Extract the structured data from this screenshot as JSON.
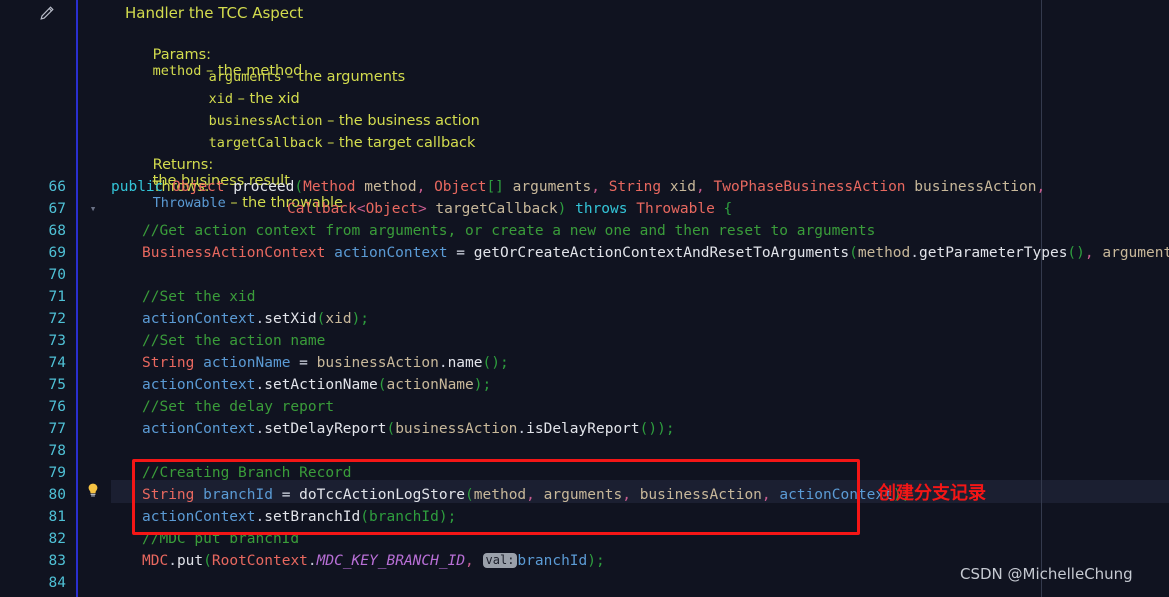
{
  "editor": {
    "background_color": "#101320",
    "gutter_rule_color": "#2a2fd0",
    "column_ruler_color": "#343a4d",
    "current_line": 80,
    "line_numbers": [
      66,
      67,
      68,
      69,
      70,
      71,
      72,
      73,
      74,
      75,
      76,
      77,
      78,
      79,
      80,
      81,
      82,
      83,
      84
    ],
    "fold_marker_line": 67,
    "lightbulb_line": 80,
    "icons": {
      "pencil": "pencil-icon",
      "fold_chevron": "chevron-down-icon",
      "lightbulb": "lightbulb-icon"
    }
  },
  "doc_popup": {
    "title": "Handler the TCC Aspect",
    "params_label": "Params:",
    "params": [
      {
        "name": "method",
        "dash": "–",
        "desc": "the method"
      },
      {
        "name": "arguments",
        "dash": "–",
        "desc": "the arguments"
      },
      {
        "name": "xid",
        "dash": "–",
        "desc": "the xid"
      },
      {
        "name": "businessAction",
        "dash": "–",
        "desc": "the business action"
      },
      {
        "name": "targetCallback",
        "dash": "–",
        "desc": "the target callback"
      }
    ],
    "returns_label": "Returns:",
    "returns_value": "the business result",
    "throws_label": "Throws:",
    "throws_type": "Throwable",
    "throws_dash": "–",
    "throws_desc": "the throwable"
  },
  "code": {
    "line66": {
      "kw_public": "public",
      "type_object": "Object",
      "name_proceed": "proceed",
      "paren_open": "(",
      "type_method": "Method",
      "param_method": " method",
      "comma1": ", ",
      "type_object2": "Object",
      "brackets": "[]",
      "param_arguments": " arguments",
      "comma2": ", ",
      "type_string": "String",
      "param_xid": " xid",
      "comma3": ", ",
      "type_twophase": "TwoPhaseBusinessAction",
      "param_businessaction": " businessAction",
      "comma4": ","
    },
    "line67": {
      "type_callback": "Callback",
      "generic_open": "<",
      "type_object": "Object",
      "generic_close": ">",
      "param_target": " targetCallback",
      "paren_close": ")",
      "kw_throws": " throws ",
      "type_throwable": "Throwable",
      "brace": " {"
    },
    "line68": "//Get action context from arguments, or create a new one and then reset to arguments",
    "line69": {
      "type": "BusinessActionContext",
      "var": "actionContext",
      "eq": " = ",
      "call": "getOrCreateActionContextAndResetToArguments",
      "open": "(",
      "arg1": "method",
      "dot": ".",
      "m1": "getParameterTypes",
      "empty": "()",
      "comma": ", ",
      "arg2": "arguments",
      "close": ");"
    },
    "line71": "//Set the xid",
    "line72": {
      "var": "actionContext",
      "dot": ".",
      "call": "setXid",
      "open": "(",
      "arg": "xid",
      "close": ");"
    },
    "line73": "//Set the action name",
    "line74": {
      "type": "String",
      "var": " actionName",
      "eq": " = ",
      "obj": "businessAction",
      "dot": ".",
      "call": "name",
      "close": "();"
    },
    "line75": {
      "var": "actionContext",
      "dot": ".",
      "call": "setActionName",
      "open": "(",
      "arg": "actionName",
      "close": ");"
    },
    "line76": "//Set the delay report",
    "line77": {
      "var": "actionContext",
      "dot": ".",
      "call": "setDelayReport",
      "open": "(",
      "obj": "businessAction",
      "dot2": ".",
      "m": "isDelayReport",
      "close": "());"
    },
    "line79": "//Creating Branch Record",
    "line80": {
      "type": "String",
      "var": " branchId",
      "eq": " = ",
      "call": "doTccActionLogStore",
      "open": "(",
      "a1": "method",
      "c1": ", ",
      "a2": "arguments",
      "c2": ", ",
      "a3": "businessAction",
      "c3": ", ",
      "a4": "actionContext",
      "close": ");"
    },
    "line81": {
      "var": "actionContext",
      "dot": ".",
      "call": "setBranchId",
      "open": "(",
      "arg": "branchId",
      "close": ");"
    },
    "line82": "//MDC put branchId",
    "line83": {
      "cls": "MDC",
      "dot": ".",
      "call": "put",
      "open": "(",
      "obj": "RootContext",
      "dot2": ".",
      "const": "MDC_KEY_BRANCH_ID",
      "comma": ", ",
      "inlay": "val:",
      "arg": "branchId",
      "close": ");"
    }
  },
  "annotation": {
    "text": "创建分支记录",
    "box_color": "#f41616"
  },
  "watermark": {
    "text": "CSDN @MichelleChung"
  }
}
